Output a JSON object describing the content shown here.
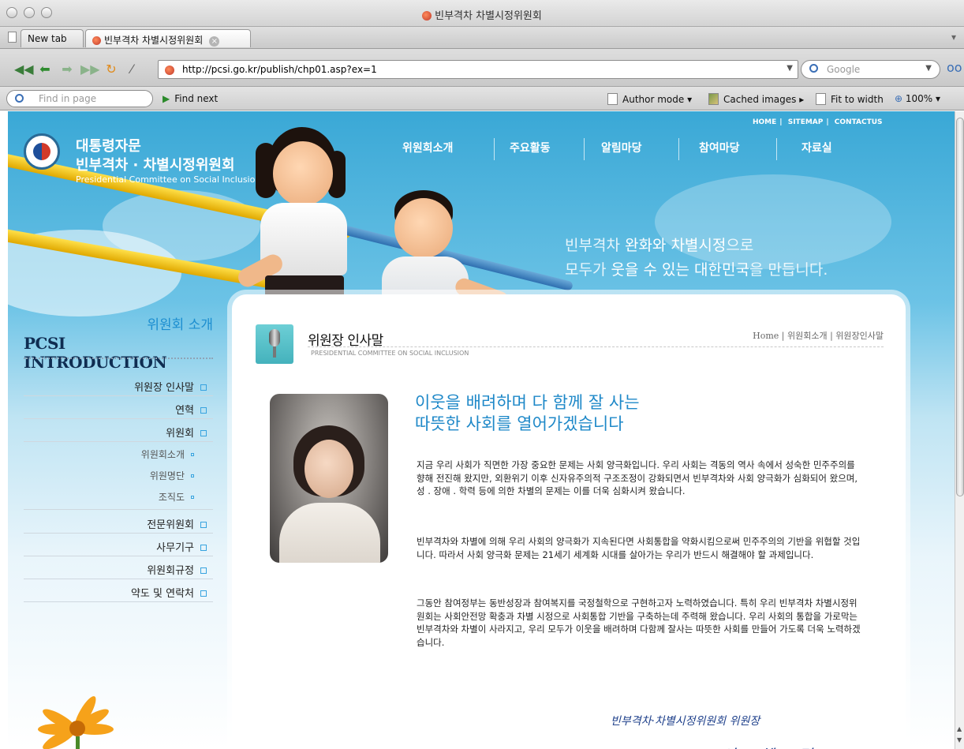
{
  "window": {
    "title": "빈부격차 차별시정위원회"
  },
  "tabs": [
    {
      "label": "New tab"
    },
    {
      "label": "빈부격차 차별시정위원회"
    }
  ],
  "address": {
    "url": "http://pcsi.go.kr/publish/chp01.asp?ex=1"
  },
  "search": {
    "placeholder": "Google"
  },
  "findbar": {
    "placeholder": "Find in page",
    "find_next": "Find next",
    "author_mode": "Author mode",
    "cached_images": "Cached images",
    "fit_to_width": "Fit to width",
    "zoom": "100%"
  },
  "site": {
    "logo": {
      "line1": "대통령자문",
      "line2": "빈부격차 · 차별시정위원회",
      "line3": "Presidential Committee on Social Inclusion"
    },
    "toplinks": [
      "HOME",
      "SITEMAP",
      "CONTACTUS"
    ],
    "menu": [
      "위원회소개",
      "주요활동",
      "알림마당",
      "참여마당",
      "자료실"
    ],
    "slogan": {
      "line1_a": "빈부격차 ",
      "line1_b": "완화와 차별시정",
      "line1_c": "으로",
      "line2_a": "모두가 ",
      "line2_b": "웃을 수 있는 대한민국",
      "line2_c": "을 만듭니다."
    }
  },
  "leftnav": {
    "title_ko": "위원회 소개",
    "title_en": "PCSI INTRODUCTION",
    "items": [
      {
        "label": "위원장 인사말"
      },
      {
        "label": "연혁"
      },
      {
        "label": "위원회"
      },
      {
        "label": "위원회소개"
      },
      {
        "label": "위원명단"
      },
      {
        "label": "조직도"
      },
      {
        "label": "전문위원회"
      },
      {
        "label": "사무기구"
      },
      {
        "label": "위원회규정"
      },
      {
        "label": "약도 및 연락처"
      }
    ]
  },
  "content": {
    "title": "위원장 인사말",
    "subtitle": "PRESIDENTIAL COMMITTEE ON SOCIAL INCLUSION",
    "breadcrumb": "Home | 위원회소개 | 위원장인사말",
    "headline1": "이웃을 배려하며 다 함께 잘 사는",
    "headline2": "따뜻한 사회를 열어가겠습니다",
    "paragraphs": [
      "지금 우리 사회가 직면한 가장 중요한 문제는 사회 양극화입니다. 우리 사회는 격동의 역사 속에서 성숙한 민주주의를 향해 전진해 왔지만, 외환위기 이후 신자유주의적 구조조정이 강화되면서 빈부격차와 사회 양극화가 심화되어 왔으며, 성 . 장애 . 학력 등에 의한 차별의 문제는 이를 더욱 심화시켜 왔습니다.",
      "빈부격차와 차별에 의해 우리 사회의 양극화가 지속된다면 사회통합을 약화시킴으로써 민주주의의 기반을 위협할 것입니다. 따라서 사회 양극화 문제는 21세기 세계화 시대를 살아가는 우리가 반드시 해결해야 할 과제입니다.",
      "그동안 참여정부는 동반성장과 참여복지를 국정철학으로 구현하고자 노력하였습니다. 특히 우리 빈부격차 차별시정위원회는 사회안전망 확충과 차별 시정으로 사회통합 기반을 구축하는데 주력해 왔습니다. 우리 사회의 통합을 가로막는 빈부격차와 차별이 사라지고, 우리 모두가 이웃을 배려하며 다함께 잘사는 따뜻한 사회를 만들어 가도록 더욱 노력하겠습니다."
    ],
    "signature": "빈부격차·차별시정위원회 위원장",
    "signature_name": "이 혜 경"
  }
}
